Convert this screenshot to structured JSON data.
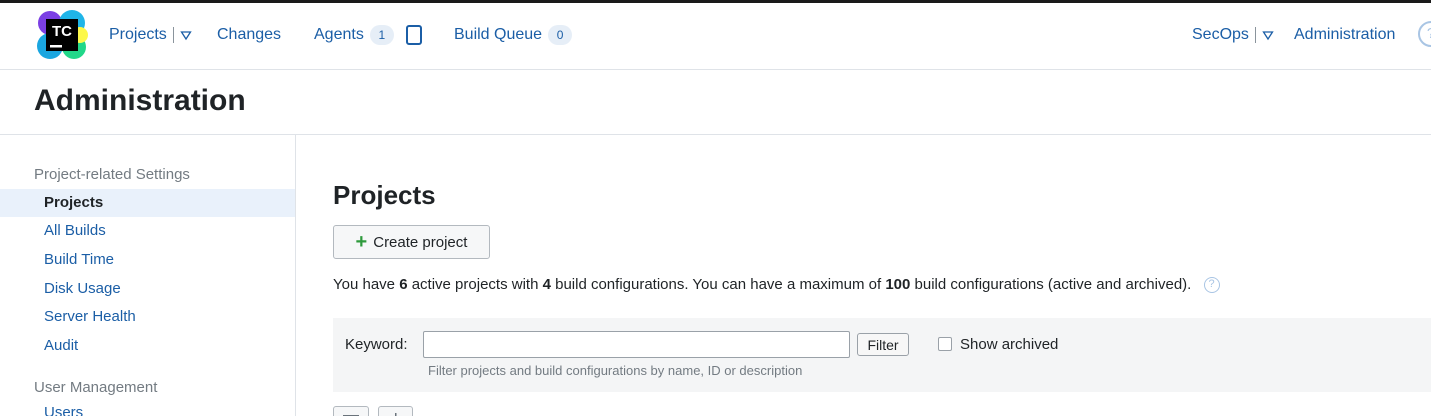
{
  "logo": {
    "text": "TC"
  },
  "header": {
    "projects": "Projects",
    "changes": "Changes",
    "agents": "Agents",
    "agents_count": "1",
    "build_queue": "Build Queue",
    "build_queue_count": "0",
    "user": "SecOps",
    "administration": "Administration",
    "help": "?"
  },
  "page": {
    "title": "Administration"
  },
  "sidebar": {
    "section1": "Project-related Settings",
    "items": [
      "Projects",
      "All Builds",
      "Build Time",
      "Disk Usage",
      "Server Health",
      "Audit"
    ],
    "section2": "User Management",
    "items2": [
      "Users"
    ]
  },
  "main": {
    "title": "Projects",
    "create_button": "Create project",
    "summary": {
      "part1": "You have ",
      "active": "6",
      "part2": " active projects with ",
      "configs": "4",
      "part3": " build configurations. You can have a maximum of ",
      "max": "100",
      "part4": " build configurations (active and archived)."
    },
    "filter": {
      "keyword_label": "Keyword:",
      "keyword_value": "",
      "filter_button": "Filter",
      "show_archived": "Show archived",
      "hint": "Filter projects and build configurations by name, ID or description"
    }
  },
  "colors": {
    "link": "#1b5ea6",
    "badge_bg": "#e6eef7",
    "active_bg": "#e9f1fb",
    "plus": "#2e9a3c"
  }
}
